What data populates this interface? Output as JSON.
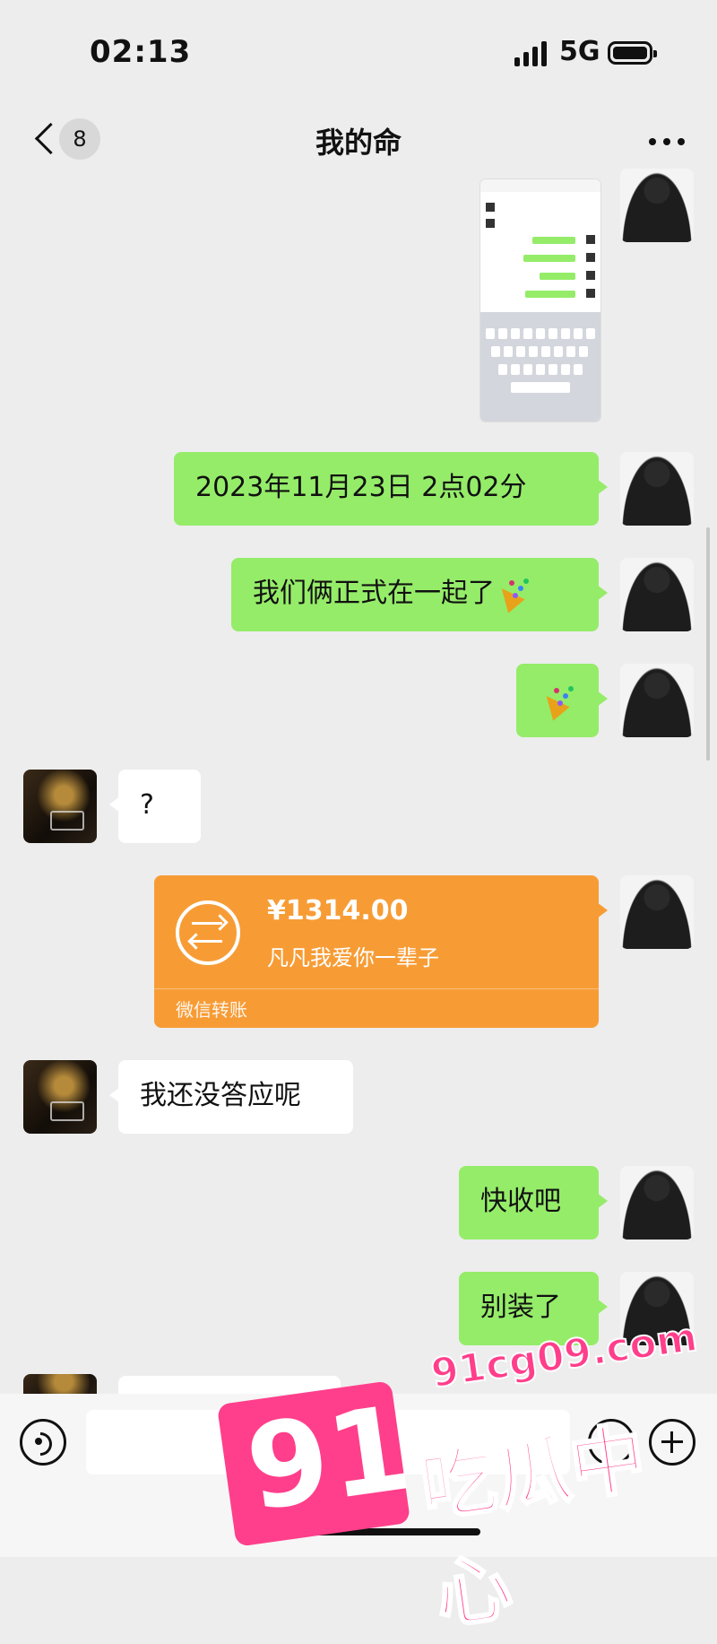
{
  "status": {
    "time": "02:13",
    "network": "5G"
  },
  "header": {
    "unread_count": "8",
    "title": "我的命"
  },
  "messages": {
    "m1": "2023年11月23日 2点02分",
    "m2": "我们俩正式在一起了",
    "m3": "?",
    "m4": "我还没答应呢",
    "m5": "快收吧",
    "m6": "别装了"
  },
  "transfer": {
    "amount": "¥1314.00",
    "note": "凡凡我爱你一辈子",
    "label": "微信转账",
    "accent": "#f79c35"
  },
  "watermark": {
    "number": "91",
    "url": "91cg09.com",
    "name": "吃瓜中心"
  },
  "colors": {
    "sent_bubble": "#95ec69",
    "received_bubble": "#ffffff",
    "background": "#ededed"
  }
}
